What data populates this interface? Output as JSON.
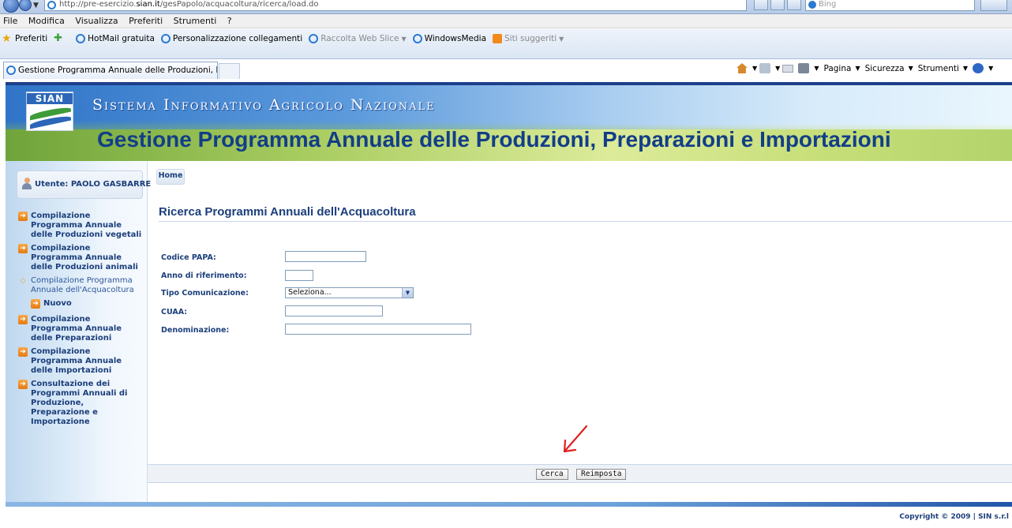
{
  "browser": {
    "url_prefix": "http://pre-esercizio.",
    "url_host": "sian.it",
    "url_path": "/gesPapolo/acquacoltura/ricerca/load.do",
    "search_placeholder": "Bing",
    "menu": [
      "File",
      "Modifica",
      "Visualizza",
      "Preferiti",
      "Strumenti",
      "?"
    ],
    "favorites": {
      "label": "Preferiti",
      "items": [
        "HotMail gratuita",
        "Personalizzazione collegamenti",
        "Raccolta Web Slice",
        "WindowsMedia",
        "Siti suggeriti"
      ]
    },
    "tab_title": "Gestione Programma Annuale delle Produzioni, Prepar...",
    "commands": [
      "Pagina",
      "Sicurezza",
      "Strumenti"
    ]
  },
  "header": {
    "logo_text": "SIAN",
    "system_title": "Sistema Informativo Agricolo Nazionale",
    "page_title": "Gestione Programma Annuale delle Produzioni, Preparazioni e Importazioni"
  },
  "sidebar": {
    "user_label": "Utente: PAOLO GASBARRE",
    "items": [
      {
        "label": "Compilazione Programma Annuale delle Produzioni vegetali"
      },
      {
        "label": "Compilazione Programma Annuale delle Produzioni animali"
      },
      {
        "label": "Compilazione Programma Annuale dell'Acquacoltura"
      },
      {
        "label": "Nuovo"
      },
      {
        "label": "Compilazione Programma Annuale delle Preparazioni"
      },
      {
        "label": "Compilazione Programma Annuale delle Importazioni"
      },
      {
        "label": "Consultazione dei Programmi Annuali di Produzione, Preparazione e Importazione"
      }
    ]
  },
  "main": {
    "breadcrumb": "Home",
    "section_title": "Ricerca Programmi Annuali dell'Acquacoltura",
    "form": {
      "codice_papa_label": "Codice PAPA:",
      "codice_papa_value": "",
      "anno_label": "Anno di riferimento:",
      "anno_value": "",
      "tipo_label": "Tipo Comunicazione:",
      "tipo_value": "Seleziona...",
      "cuaa_label": "CUAA:",
      "cuaa_value": "",
      "denominazione_label": "Denominazione:",
      "denominazione_value": ""
    },
    "buttons": {
      "search": "Cerca",
      "reset": "Reimposta"
    }
  },
  "footer": {
    "copyright": "Copyright © 2009 | SIN s.r.l"
  },
  "colors": {
    "accent": "#1c3f7b",
    "annotation_arrow": "#e02020"
  }
}
